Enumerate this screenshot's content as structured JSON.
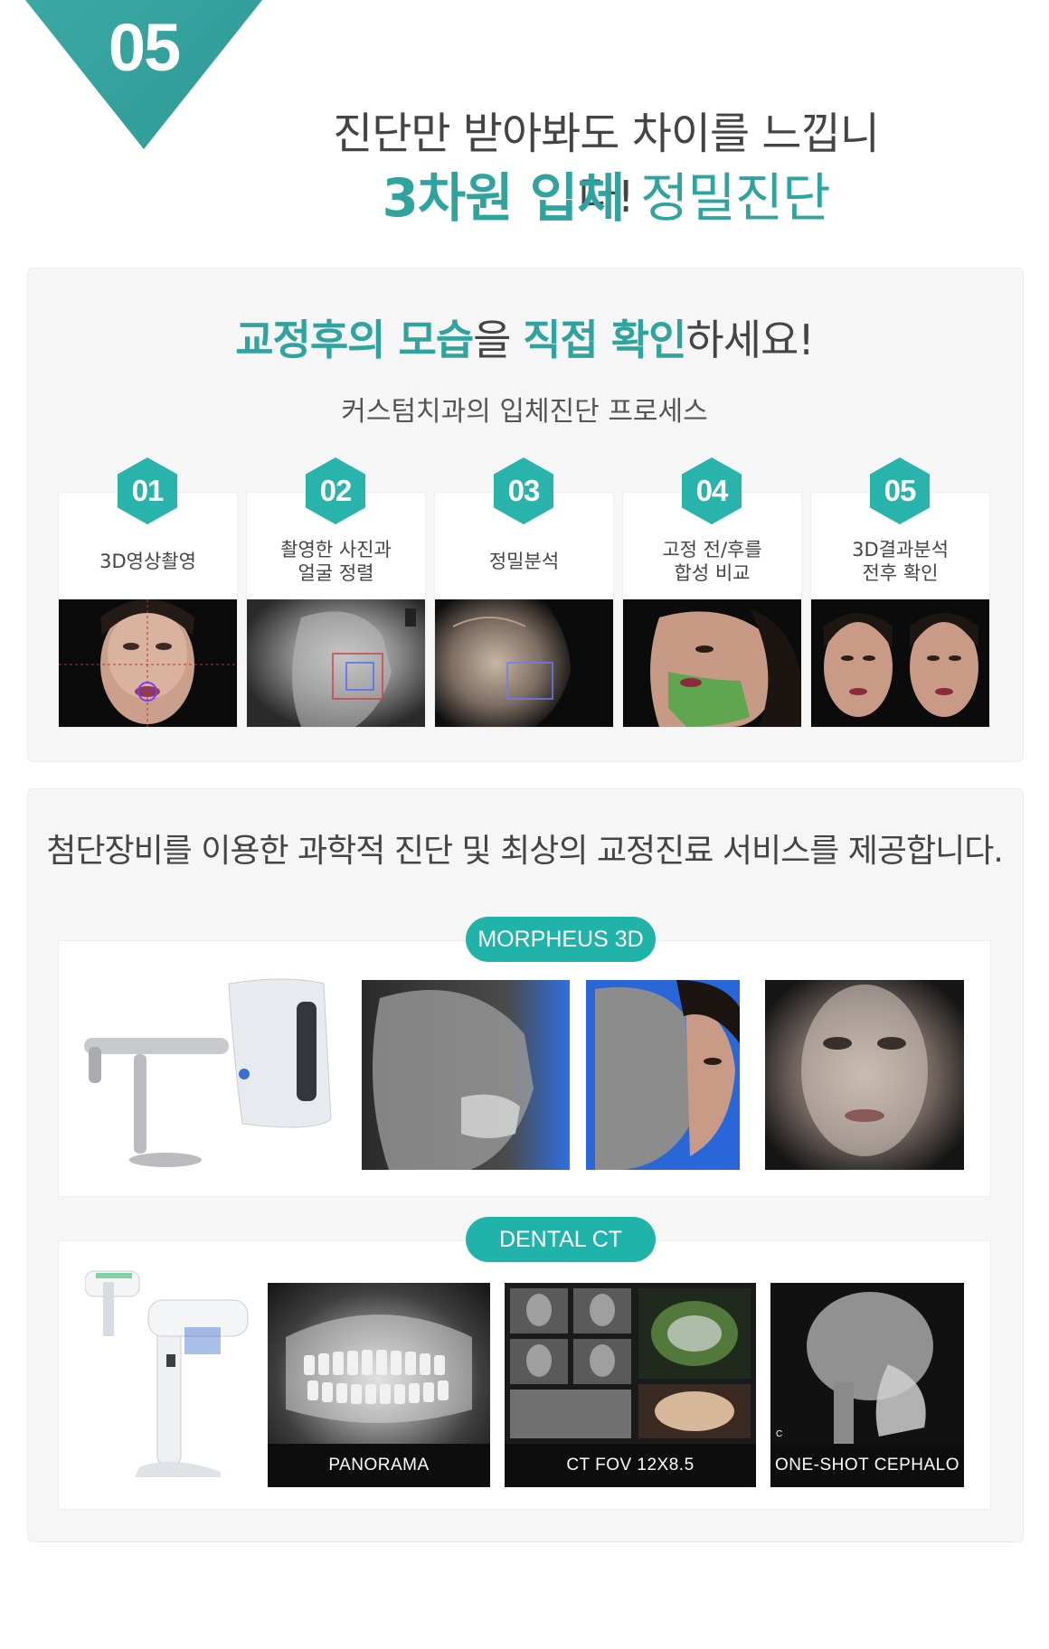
{
  "header": {
    "step_number": "05",
    "line1": "진단만 받아봐도 차이를 느낍니다!",
    "line2_bold": "3차원 입체",
    "line2_light": " 정밀진단"
  },
  "process": {
    "title_hl1": "교정후의 모습",
    "title_t1": "을 ",
    "title_hl2": "직접 확인",
    "title_t2": "하세요!",
    "subtitle": "커스텀치과의 입체진단 프로세스",
    "steps": [
      {
        "number": "01",
        "label": "3D영상촬영"
      },
      {
        "number": "02",
        "label": "촬영한 사진과\n얼굴 정렬"
      },
      {
        "number": "03",
        "label": "정밀분석"
      },
      {
        "number": "04",
        "label": "고정 전/후를\n합성 비교"
      },
      {
        "number": "05",
        "label": "3D결과분석\n전후 확인"
      }
    ]
  },
  "equipment": {
    "title": "첨단장비를 이용한 과학적 진단 및 최상의 교정진료 서비스를 제공합니다.",
    "morpheus": {
      "label": "MORPHEUS 3D"
    },
    "dental_ct": {
      "label": "DENTAL CT",
      "images": [
        {
          "caption": "PANORAMA"
        },
        {
          "caption": "CT FOV 12X8.5"
        },
        {
          "caption": "ONE-SHOT CEPHALO"
        }
      ]
    }
  },
  "colors": {
    "accent": "#2fa39d",
    "badge": "#28b4ab",
    "pill": "#20b3aa"
  }
}
